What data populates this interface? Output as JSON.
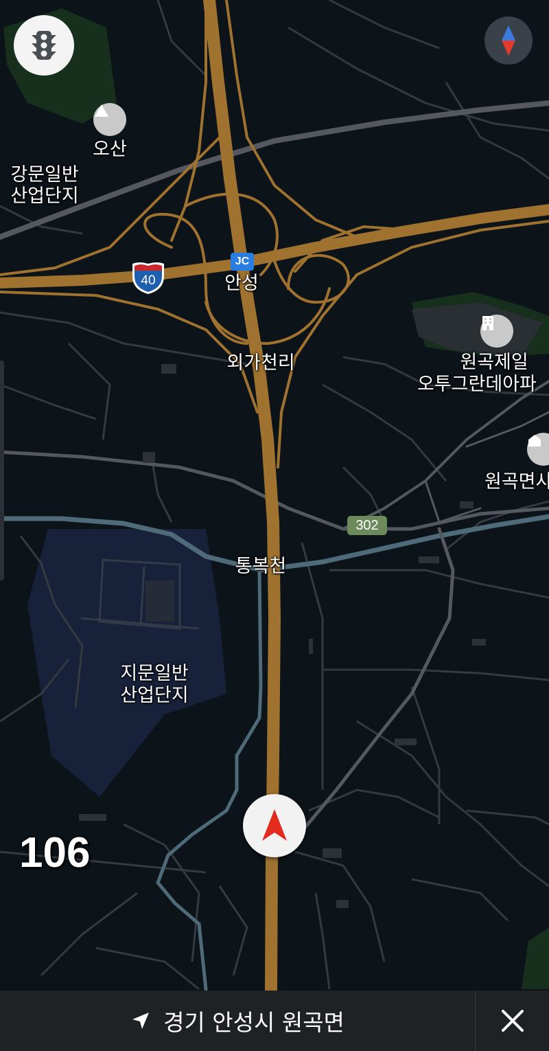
{
  "map": {
    "labels": {
      "osan": "오산",
      "gangmun_1": "강문일반",
      "gangmun_2": "산업단지",
      "anseong": "안성",
      "oegacheon": "외가천리",
      "wongok_1": "원곡제일",
      "wongok_2": "오투그란데아파",
      "wongokmyeon": "원곡면사",
      "tongbokcheon": "통복천",
      "jimun_1": "지문일반",
      "jimun_2": "산업단지"
    },
    "highway_shield": "40",
    "junction_badge": "JC",
    "route_badge": "302",
    "colors": {
      "background": "#0c1319",
      "highway": "#a07230",
      "road": "#3d4248",
      "arterial": "#55595d",
      "river": "#4f6a78",
      "industrial_area": "#18213a",
      "park": "#17331f"
    }
  },
  "controls": {
    "traffic_icon": "traffic-light-icon",
    "compass_icon": "compass-icon",
    "navigation_icon": "navigation-arrow-icon"
  },
  "speed": "106",
  "bottom_bar": {
    "location_icon": "location-arrow-icon",
    "address": "경기 안성시 원곡면",
    "close_icon": "close-icon"
  }
}
